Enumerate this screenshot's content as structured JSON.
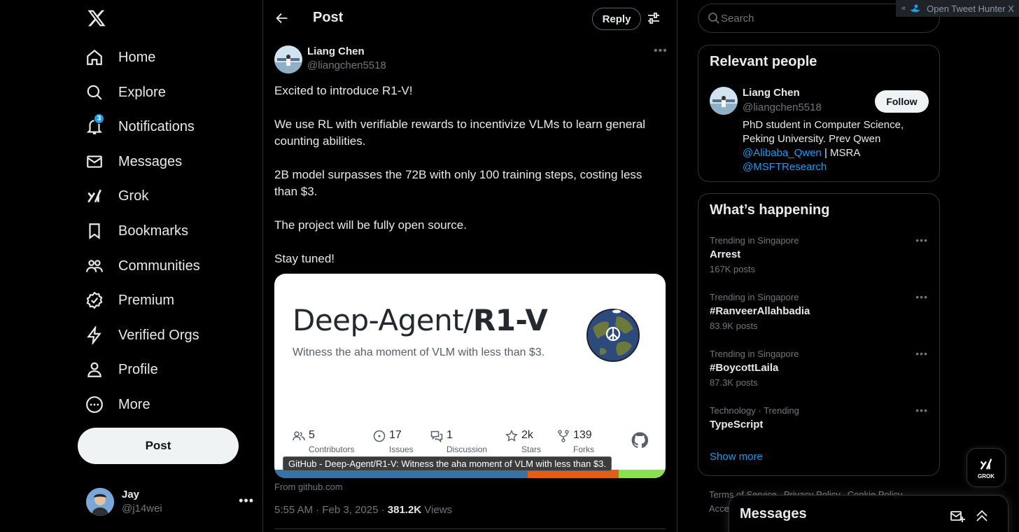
{
  "nav": {
    "items": [
      {
        "label": "Home"
      },
      {
        "label": "Explore"
      },
      {
        "label": "Notifications",
        "badge": "3"
      },
      {
        "label": "Messages"
      },
      {
        "label": "Grok"
      },
      {
        "label": "Bookmarks"
      },
      {
        "label": "Communities"
      },
      {
        "label": "Premium"
      },
      {
        "label": "Verified Orgs"
      },
      {
        "label": "Profile"
      },
      {
        "label": "More"
      }
    ],
    "post_button": "Post",
    "account": {
      "name": "Jay",
      "handle": "@j14wei"
    }
  },
  "header": {
    "title": "Post",
    "reply_button": "Reply"
  },
  "post": {
    "author_name": "Liang Chen",
    "author_handle": "@liangchen5518",
    "text": "Excited to introduce R1-V!\n\nWe use RL with verifiable rewards to incentivize VLMs to learn general counting abilities.\n\n2B model surpasses the 72B with only 100 training steps, costing less than $3.\n\nThe project will be fully open source.\n\nStay tuned!",
    "card": {
      "title_owner": "Deep-Agent/",
      "title_repo": "R1-V",
      "description": "Witness the aha moment of VLM with less than $3.",
      "stats": [
        {
          "num": "5",
          "label": "Contributors",
          "icon": "people-icon"
        },
        {
          "num": "17",
          "label": "Issues",
          "icon": "issue-icon"
        },
        {
          "num": "1",
          "label": "Discussion",
          "icon": "discussion-icon"
        },
        {
          "num": "2k",
          "label": "Stars",
          "icon": "star-icon"
        },
        {
          "num": "139",
          "label": "Forks",
          "icon": "fork-icon"
        }
      ],
      "tooltip": "GitHub - Deep-Agent/R1-V: Witness the aha moment of VLM with less than $3.",
      "language_bar_colors": [
        "#3572A5",
        "#e05d1a",
        "#89e051"
      ]
    },
    "source": "From github.com",
    "time": "5:55 AM · Feb 3, 2025 · ",
    "views_count": "381.2K",
    "views_label": " Views"
  },
  "search": {
    "placeholder": "Search"
  },
  "tweet_hunter": {
    "label": "Open Tweet Hunter X"
  },
  "relevant_people": {
    "title": "Relevant people",
    "name": "Liang Chen",
    "handle": "@liangchen5518",
    "follow": "Follow",
    "bio_text": "PhD student in Computer Science, Peking University. Prev Qwen ",
    "bio_link1": "@Alibaba_Qwen",
    "bio_mid": " | MSRA ",
    "bio_link2": "@MSFTResearch"
  },
  "whats_happening": {
    "title": "What’s happening",
    "trends": [
      {
        "context": "Trending in Singapore",
        "name": "Arrest",
        "count": "167K posts"
      },
      {
        "context": "Trending in Singapore",
        "name": "#RanveerAllahbadia",
        "count": "83.9K posts"
      },
      {
        "context": "Trending in Singapore",
        "name": "#BoycottLaila",
        "count": "87.3K posts"
      },
      {
        "context": "Technology · Trending",
        "name": "TypeScript",
        "count": ""
      }
    ],
    "show_more": "Show more"
  },
  "footer": {
    "links": [
      "Terms of Service",
      "Privacy Policy",
      "Cookie Policy"
    ],
    "more": "Acce"
  },
  "grok_button": {
    "label": "GROK"
  },
  "messages_drawer": {
    "title": "Messages"
  }
}
